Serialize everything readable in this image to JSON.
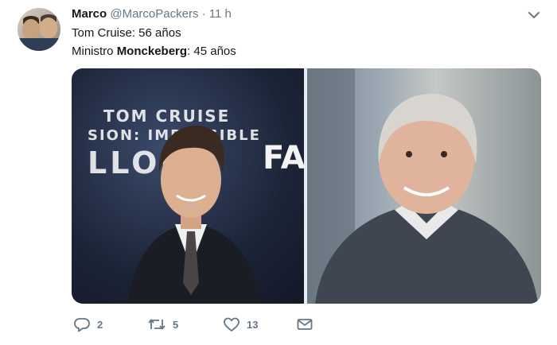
{
  "tweet": {
    "author_name": "Marco",
    "author_handle": "@MarcoPackers",
    "separator": "·",
    "time": "11 h",
    "line1": "Tom Cruise: 56 años",
    "line2_prefix": "Ministro ",
    "line2_bold": "Monckeberg",
    "line2_suffix": ": 45 años"
  },
  "media": {
    "left_photo": {
      "poster_line1": "TOM CRUISE",
      "poster_line2": "SION: IMPOSSIBLE",
      "poster_line3": "LLOUT",
      "poster_right": "FA"
    }
  },
  "actions": {
    "reply_count": "2",
    "retweet_count": "5",
    "like_count": "13"
  },
  "colors": {
    "accent": "#1da1f2",
    "muted": "#657786"
  }
}
